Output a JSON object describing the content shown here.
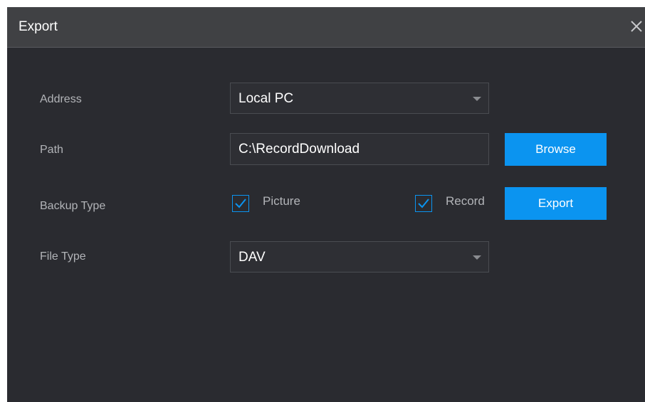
{
  "dialog": {
    "title": "Export",
    "close_icon": "close-icon"
  },
  "form": {
    "address": {
      "label": "Address",
      "value": "Local PC",
      "arrow_icon": "caret-down-icon"
    },
    "path": {
      "label": "Path",
      "value": "C:\\RecordDownload"
    },
    "backup_type": {
      "label": "Backup Type",
      "options": [
        {
          "label": "Picture",
          "checked": true
        },
        {
          "label": "Record",
          "checked": true
        }
      ]
    },
    "file_type": {
      "label": "File Type",
      "value": "DAV",
      "arrow_icon": "caret-down-icon"
    }
  },
  "buttons": {
    "browse": "Browse",
    "export": "Export"
  },
  "colors": {
    "background": "#2a2b30",
    "title_bar": "#404144",
    "accent": "#0b94f0",
    "label": "#b2b4b8",
    "text": "#ffffff"
  }
}
